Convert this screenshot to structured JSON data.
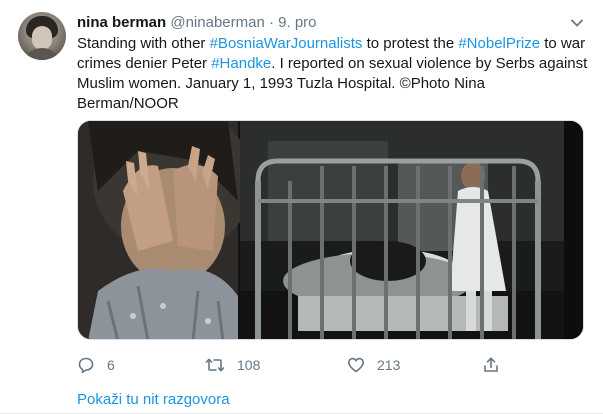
{
  "author": {
    "name": "nina berman",
    "handle": "@ninaberman",
    "separator": "·",
    "date": "9. pro"
  },
  "tweet": {
    "segments": [
      {
        "text": "Standing with other ",
        "type": "text"
      },
      {
        "text": "#BosniaWarJournalists",
        "type": "hashtag"
      },
      {
        "text": " to protest the ",
        "type": "text"
      },
      {
        "text": "#NobelPrize",
        "type": "hashtag"
      },
      {
        "text": " to war crimes denier Peter ",
        "type": "text"
      },
      {
        "text": "#Handke",
        "type": "hashtag"
      },
      {
        "text": ". I reported on sexual violence by Serbs against Muslim women.  January 1, 1993  Tuzla Hospital.  ©Photo Nina Berman/NOOR",
        "type": "text"
      }
    ]
  },
  "actions": {
    "reply": {
      "icon": "reply-icon",
      "count": "6"
    },
    "retweet": {
      "icon": "retweet-icon",
      "count": "108"
    },
    "like": {
      "icon": "heart-icon",
      "count": "213"
    },
    "share": {
      "icon": "share-icon"
    }
  },
  "thread_link": "Pokaži tu nit razgovora",
  "colors": {
    "link": "#1b95e0",
    "muted": "#657786",
    "text": "#14171a"
  }
}
